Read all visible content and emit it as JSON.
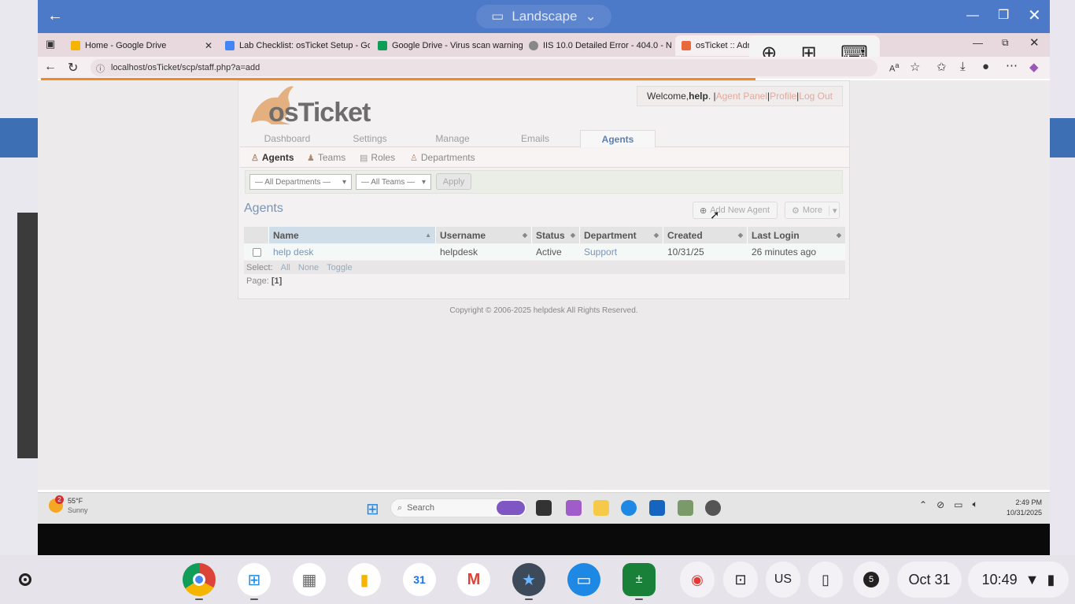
{
  "window": {
    "orientation_label": "Landscape"
  },
  "browser": {
    "tabs": [
      {
        "title": "Home - Google Drive",
        "color": "#f4b400"
      },
      {
        "title": "Lab Checklist: osTicket Setup - Go",
        "color": "#4285f4"
      },
      {
        "title": "Google Drive - Virus scan warning",
        "color": "#0f9d58"
      },
      {
        "title": "IIS 10.0 Detailed Error - 404.0 - N",
        "color": "#666666"
      },
      {
        "title": "osTicket :: Admi",
        "color": "#e8693a"
      }
    ],
    "url": "localhost/osTicket/scp/staff.php?a=add"
  },
  "osticket": {
    "logo_text": "osTicket",
    "welcome": {
      "prefix": "Welcome, ",
      "user": "help",
      "agent_panel": "Agent Panel",
      "profile": "Profile",
      "logout": "Log Out"
    },
    "nav": [
      "Dashboard",
      "Settings",
      "Manage",
      "Emails",
      "Agents"
    ],
    "subnav": [
      "Agents",
      "Teams",
      "Roles",
      "Departments"
    ],
    "filters": {
      "departments": "— All Departments —",
      "teams": "— All Teams —",
      "apply": "Apply"
    },
    "page_title": "Agents",
    "add_new_agent": "Add New Agent",
    "more": "More",
    "table": {
      "headers": [
        "Name",
        "Username",
        "Status",
        "Department",
        "Created",
        "Last Login"
      ],
      "rows": [
        {
          "name": "help desk",
          "username": "helpdesk",
          "status": "Active",
          "department": "Support",
          "created": "10/31/25",
          "last_login": "26 minutes ago"
        }
      ]
    },
    "select": {
      "label": "Select:",
      "all": "All",
      "none": "None",
      "toggle": "Toggle"
    },
    "page": {
      "label": "Page:",
      "value": "[1]"
    },
    "copyright": "Copyright © 2006-2025 helpdesk All Rights Reserved."
  },
  "windows_taskbar": {
    "weather": {
      "temp": "55°F",
      "condition": "Sunny",
      "badge": "2"
    },
    "search_placeholder": "Search",
    "time": "2:49 PM",
    "date": "10/31/2025"
  },
  "chromeos_shelf": {
    "keyboard": "US",
    "notifications": "5",
    "date": "Oct 31",
    "time": "10:49"
  }
}
